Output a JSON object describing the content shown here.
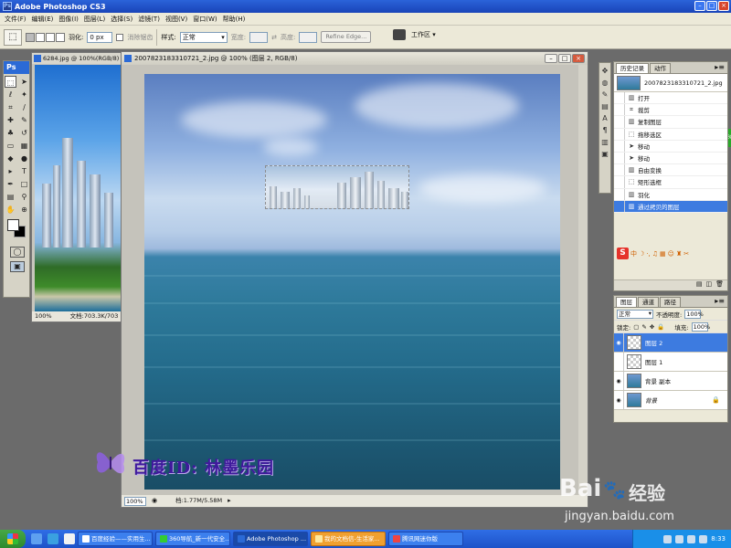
{
  "app": {
    "title": "Adobe Photoshop CS3"
  },
  "menu": [
    "文件(F)",
    "编辑(E)",
    "图像(I)",
    "图层(L)",
    "选择(S)",
    "滤镜(T)",
    "视图(V)",
    "窗口(W)",
    "帮助(H)"
  ],
  "options": {
    "feather_label": "羽化:",
    "feather_value": "0 px",
    "antialias_label": "消除锯齿",
    "style_label": "样式:",
    "style_value": "正常",
    "width_label": "宽度:",
    "height_label": "高度:",
    "refine_edge": "Refine Edge...",
    "workspace": "工作区 ▾"
  },
  "doc1": {
    "title": "6284.jpg @ 100%(RGB/8)",
    "zoom": "100%",
    "file_info": "文档:703.3K/703"
  },
  "doc2": {
    "title": "2007823183310721_2.jpg @ 100% (图层 2, RGB/8)",
    "zoom": "100%",
    "file_info": "档:1.77M/5.58M"
  },
  "watermark_text": "百度ID: 林墨乐园",
  "history": {
    "tabs": [
      "历史记录",
      "动作"
    ],
    "snapshot": "2007823183310721_2.jpg",
    "steps": [
      "打开",
      "裁剪",
      "复制图层",
      "拖移选区",
      "移动",
      "移动",
      "自由变换",
      "矩形选框",
      "羽化",
      "通过拷贝的图层"
    ]
  },
  "layers": {
    "tabs": [
      "图层",
      "通道",
      "路径"
    ],
    "blend_mode": "正常",
    "opacity_label": "不透明度:",
    "opacity_value": "100%",
    "lock_label": "锁定:",
    "fill_label": "填充:",
    "fill_value": "100%",
    "items": [
      "图层 2",
      "图层 1",
      "背景 副本",
      "背景"
    ]
  },
  "taskbar": {
    "items": [
      "百度经验——实用生...",
      "360导航_新一代安全...",
      "Adobe Photoshop ...",
      "我的文档信-生活家...",
      "腾讯网迷你版"
    ],
    "clock": "8:33"
  },
  "baidu": {
    "brand": "Bai",
    "brand2": "经验",
    "url": "jingyan.baidu.com"
  }
}
